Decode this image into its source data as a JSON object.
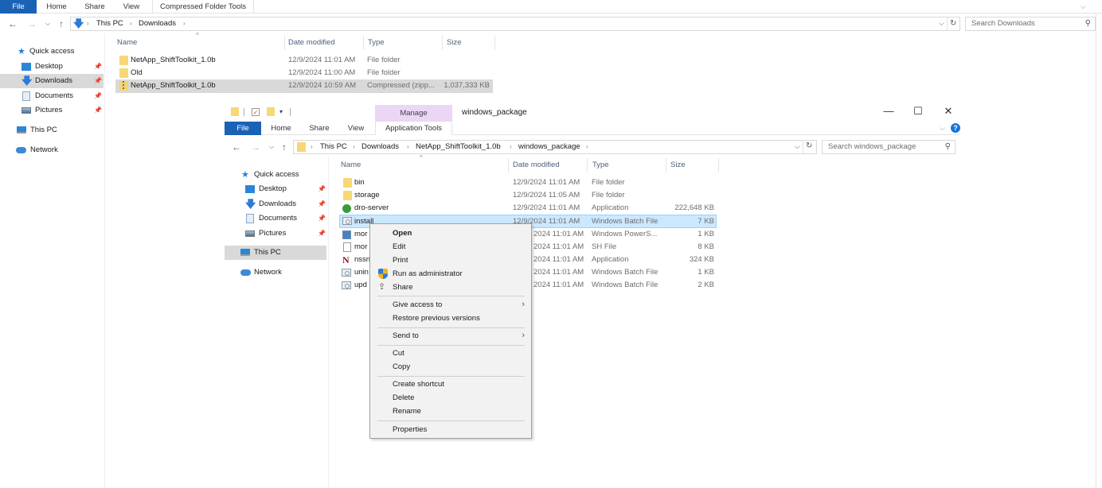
{
  "background_window": {
    "ribbon_tabs": [
      "File",
      "Home",
      "Share",
      "View",
      "Compressed Folder Tools"
    ],
    "breadcrumb": [
      "This PC",
      "Downloads"
    ],
    "search_placeholder": "Search Downloads",
    "nav": {
      "quick_access": "Quick access",
      "items": [
        {
          "label": "Desktop",
          "icon": "desktop-icon",
          "pinned": true
        },
        {
          "label": "Downloads",
          "icon": "downloads-icon",
          "pinned": true,
          "selected": true
        },
        {
          "label": "Documents",
          "icon": "documents-icon",
          "pinned": true
        },
        {
          "label": "Pictures",
          "icon": "pictures-icon",
          "pinned": true
        }
      ],
      "this_pc": "This PC",
      "network": "Network"
    },
    "columns": [
      "Name",
      "Date modified",
      "Type",
      "Size"
    ],
    "files": [
      {
        "name": "NetApp_ShiftToolkit_1.0b",
        "date": "12/9/2024 11:01 AM",
        "type": "File folder",
        "size": "",
        "icon": "folder-icon"
      },
      {
        "name": "Old",
        "date": "12/9/2024 11:00 AM",
        "type": "File folder",
        "size": "",
        "icon": "folder-icon"
      },
      {
        "name": "NetApp_ShiftToolkit_1.0b",
        "date": "12/9/2024 10:59 AM",
        "type": "Compressed (zipp...",
        "size": "1,037,333 KB",
        "icon": "zip-folder-icon",
        "selected": true
      }
    ]
  },
  "foreground_window": {
    "title": "windows_package",
    "context_tab_group": "Manage",
    "ribbon_tabs": [
      "File",
      "Home",
      "Share",
      "View",
      "Application Tools"
    ],
    "breadcrumb": [
      "This PC",
      "Downloads",
      "NetApp_ShiftToolkit_1.0b",
      "windows_package"
    ],
    "search_placeholder": "Search windows_package",
    "window_controls": {
      "minimize": "—",
      "maximize": "☐",
      "close": "✕"
    },
    "nav": {
      "quick_access": "Quick access",
      "items": [
        {
          "label": "Desktop",
          "pinned": true
        },
        {
          "label": "Downloads",
          "pinned": true
        },
        {
          "label": "Documents",
          "pinned": true
        },
        {
          "label": "Pictures",
          "pinned": true
        }
      ],
      "this_pc": "This PC",
      "network": "Network"
    },
    "columns": [
      "Name",
      "Date modified",
      "Type",
      "Size"
    ],
    "files": [
      {
        "name": "bin",
        "date": "12/9/2024 11:01 AM",
        "type": "File folder",
        "size": "",
        "icon": "folder-icon"
      },
      {
        "name": "storage",
        "date": "12/9/2024 11:05 AM",
        "type": "File folder",
        "size": "",
        "icon": "folder-icon"
      },
      {
        "name": "dro-server",
        "date": "12/9/2024 11:01 AM",
        "type": "Application",
        "size": "222,648 KB",
        "icon": "app-icon"
      },
      {
        "name": "install",
        "date": "12/9/2024 11:01 AM",
        "type": "Windows Batch File",
        "size": "7 KB",
        "icon": "batch-file-icon",
        "selected": true
      },
      {
        "name": "mor",
        "date": "2024 11:01 AM",
        "type": "Windows PowerS...",
        "size": "1 KB",
        "icon": "powershell-icon"
      },
      {
        "name": "mor",
        "date": "2024 11:01 AM",
        "type": "SH File",
        "size": "8 KB",
        "icon": "blank-file-icon"
      },
      {
        "name": "nssn",
        "date": "2024 11:01 AM",
        "type": "Application",
        "size": "324 KB",
        "icon": "nssm-icon"
      },
      {
        "name": "unin",
        "date": "2024 11:01 AM",
        "type": "Windows Batch File",
        "size": "1 KB",
        "icon": "batch-file-icon"
      },
      {
        "name": "upd",
        "date": "2024 11:01 AM",
        "type": "Windows Batch File",
        "size": "2 KB",
        "icon": "batch-file-icon"
      }
    ]
  },
  "context_menu": {
    "groups": [
      [
        {
          "label": "Open",
          "bold": true
        },
        {
          "label": "Edit"
        },
        {
          "label": "Print"
        },
        {
          "label": "Run as administrator",
          "icon": "shield-icon"
        },
        {
          "label": "Share",
          "icon": "share-icon"
        }
      ],
      [
        {
          "label": "Give access to",
          "submenu": true
        },
        {
          "label": "Restore previous versions"
        }
      ],
      [
        {
          "label": "Send to",
          "submenu": true
        }
      ],
      [
        {
          "label": "Cut"
        },
        {
          "label": "Copy"
        }
      ],
      [
        {
          "label": "Create shortcut"
        },
        {
          "label": "Delete"
        },
        {
          "label": "Rename"
        }
      ],
      [
        {
          "label": "Properties"
        }
      ]
    ]
  },
  "colors": {
    "file_tab": "#1a62b6",
    "manage_tab": "#ebd6f5",
    "selection_blue": "#cce8ff",
    "selection_gray": "#d9d9d9",
    "column_header": "#4c607a"
  }
}
